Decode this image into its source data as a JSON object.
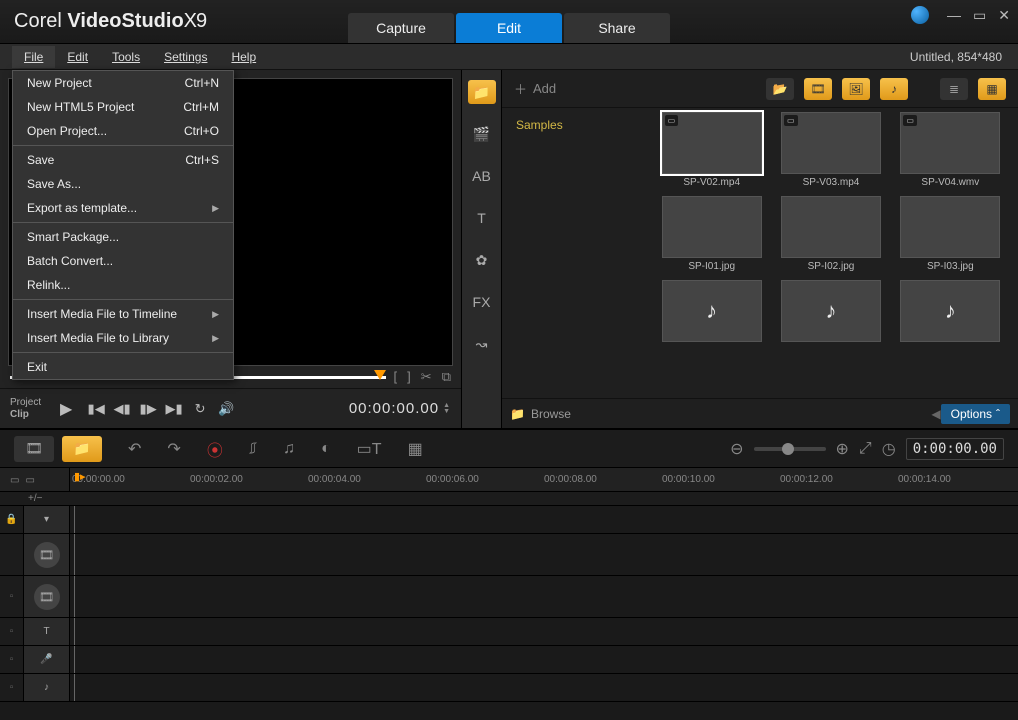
{
  "app": {
    "brand": "Corel",
    "name": "VideoStudio",
    "ver": "X9"
  },
  "tabs": {
    "capture": "Capture",
    "edit": "Edit",
    "share": "Share"
  },
  "docinfo": "Untitled, 854*480",
  "menubar": {
    "file": "File",
    "edit": "Edit",
    "tools": "Tools",
    "settings": "Settings",
    "help": "Help"
  },
  "filemenu": {
    "new_project": "New Project",
    "new_project_sc": "Ctrl+N",
    "new_html5": "New HTML5 Project",
    "new_html5_sc": "Ctrl+M",
    "open": "Open Project...",
    "open_sc": "Ctrl+O",
    "save": "Save",
    "save_sc": "Ctrl+S",
    "save_as": "Save As...",
    "export_tpl": "Export as template...",
    "smart_pkg": "Smart Package...",
    "batch": "Batch Convert...",
    "relink": "Relink...",
    "insert_timeline": "Insert Media File to Timeline",
    "insert_library": "Insert Media File to Library",
    "exit": "Exit"
  },
  "player": {
    "mode_project": "Project",
    "mode_clip": "Clip",
    "timecode": "00:00:00.00"
  },
  "library": {
    "add": "Add",
    "folder_samples": "Samples",
    "browse": "Browse",
    "options": "Options",
    "items": [
      {
        "label": "SP-V02.mp4",
        "cls": "bg-v02",
        "sel": true,
        "vid": true
      },
      {
        "label": "SP-V03.mp4",
        "cls": "bg-v03",
        "vid": true
      },
      {
        "label": "SP-V04.wmv",
        "cls": "bg-v04",
        "vid": true
      },
      {
        "label": "SP-I01.jpg",
        "cls": "bg-i01"
      },
      {
        "label": "SP-I02.jpg",
        "cls": "bg-i02"
      },
      {
        "label": "SP-I03.jpg",
        "cls": "bg-i03"
      },
      {
        "label": "",
        "cls": "bg-audio"
      },
      {
        "label": "",
        "cls": "bg-audio"
      },
      {
        "label": "",
        "cls": "bg-audio"
      }
    ]
  },
  "timeline": {
    "timecode": "0:00:00.00",
    "ticks": [
      "00:00:00.00",
      "00:00:02.00",
      "00:00:04.00",
      "00:00:06.00",
      "00:00:08.00",
      "00:00:10.00",
      "00:00:12.00",
      "00:00:14.00"
    ],
    "plusminus": "+/−"
  }
}
